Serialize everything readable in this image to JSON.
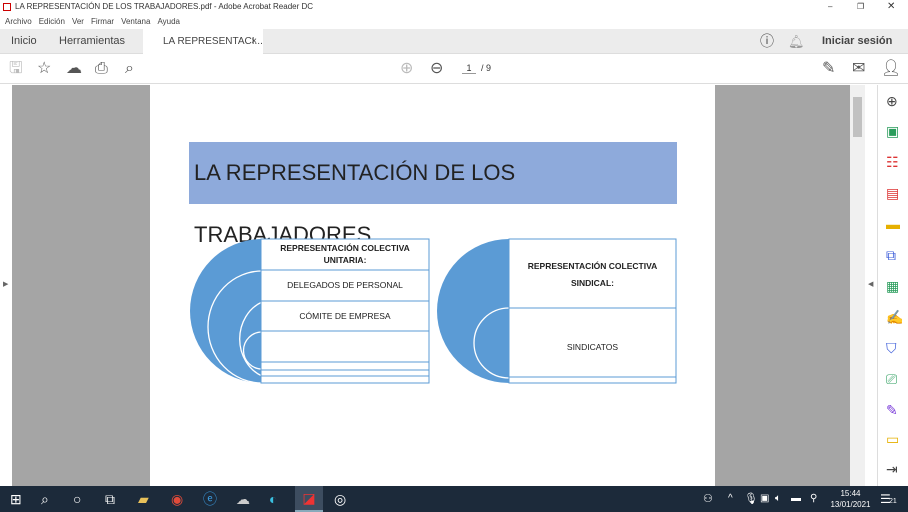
{
  "window": {
    "title": "LA REPRESENTACIÓN DE LOS TRABAJADORES.pdf - Adobe Acrobat Reader DC"
  },
  "menu": [
    "Archivo",
    "Edición",
    "Ver",
    "Firmar",
    "Ventana",
    "Ayuda"
  ],
  "tabs": {
    "home": "Inicio",
    "tools": "Herramientas",
    "doc": "LA REPRESENTACI...",
    "close": "×",
    "signin": "Iniciar sesión"
  },
  "toolbar": {
    "page_current": "1",
    "page_total": "/ 9"
  },
  "document": {
    "title": "LA REPRESENTACIÓN DE  LOS TRABAJADORES",
    "left": {
      "heading_line1": "REPRESENTACIÓN COLECTIVA",
      "heading_line2": "UNITARIA:",
      "item1": "DELEGADOS DE PERSONAL",
      "item2": "CÓMITE DE EMPRESA"
    },
    "right": {
      "heading_line1": "REPRESENTACIÓN COLECTIVA",
      "heading_line2": "SINDICAL:",
      "item1": "SINDICATOS"
    }
  },
  "taskbar": {
    "time": "15:44",
    "date": "13/01/2021",
    "notifications": "21"
  },
  "colors": {
    "accent": "#5b9bd5",
    "header_box": "#8eaadb",
    "taskbar": "#1c2a3a"
  }
}
